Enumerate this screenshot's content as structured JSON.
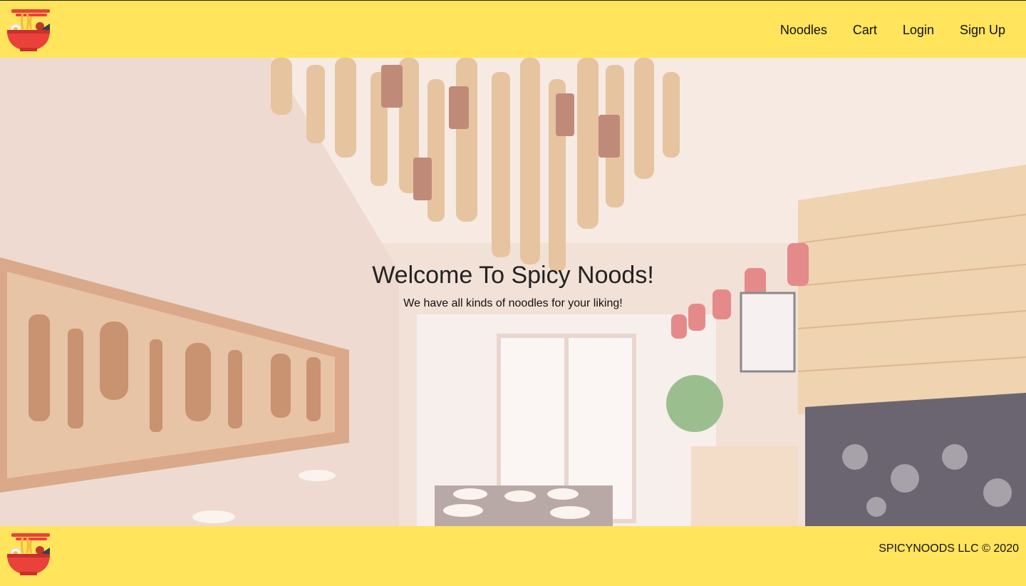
{
  "header": {
    "logo_icon": "noodle-bowl-icon",
    "nav": [
      {
        "label": "Noodles"
      },
      {
        "label": "Cart"
      },
      {
        "label": "Login"
      },
      {
        "label": "Sign Up"
      }
    ]
  },
  "hero": {
    "title": "Welcome To Spicy Noods!",
    "subtitle": "We have all kinds of noodles for your liking!"
  },
  "footer": {
    "logo_icon": "noodle-bowl-icon",
    "copyright": "SPICYNOODS LLC © 2020"
  },
  "colors": {
    "bar": "#FFE45C",
    "bowl": "#E8423A",
    "text": "#111111"
  }
}
